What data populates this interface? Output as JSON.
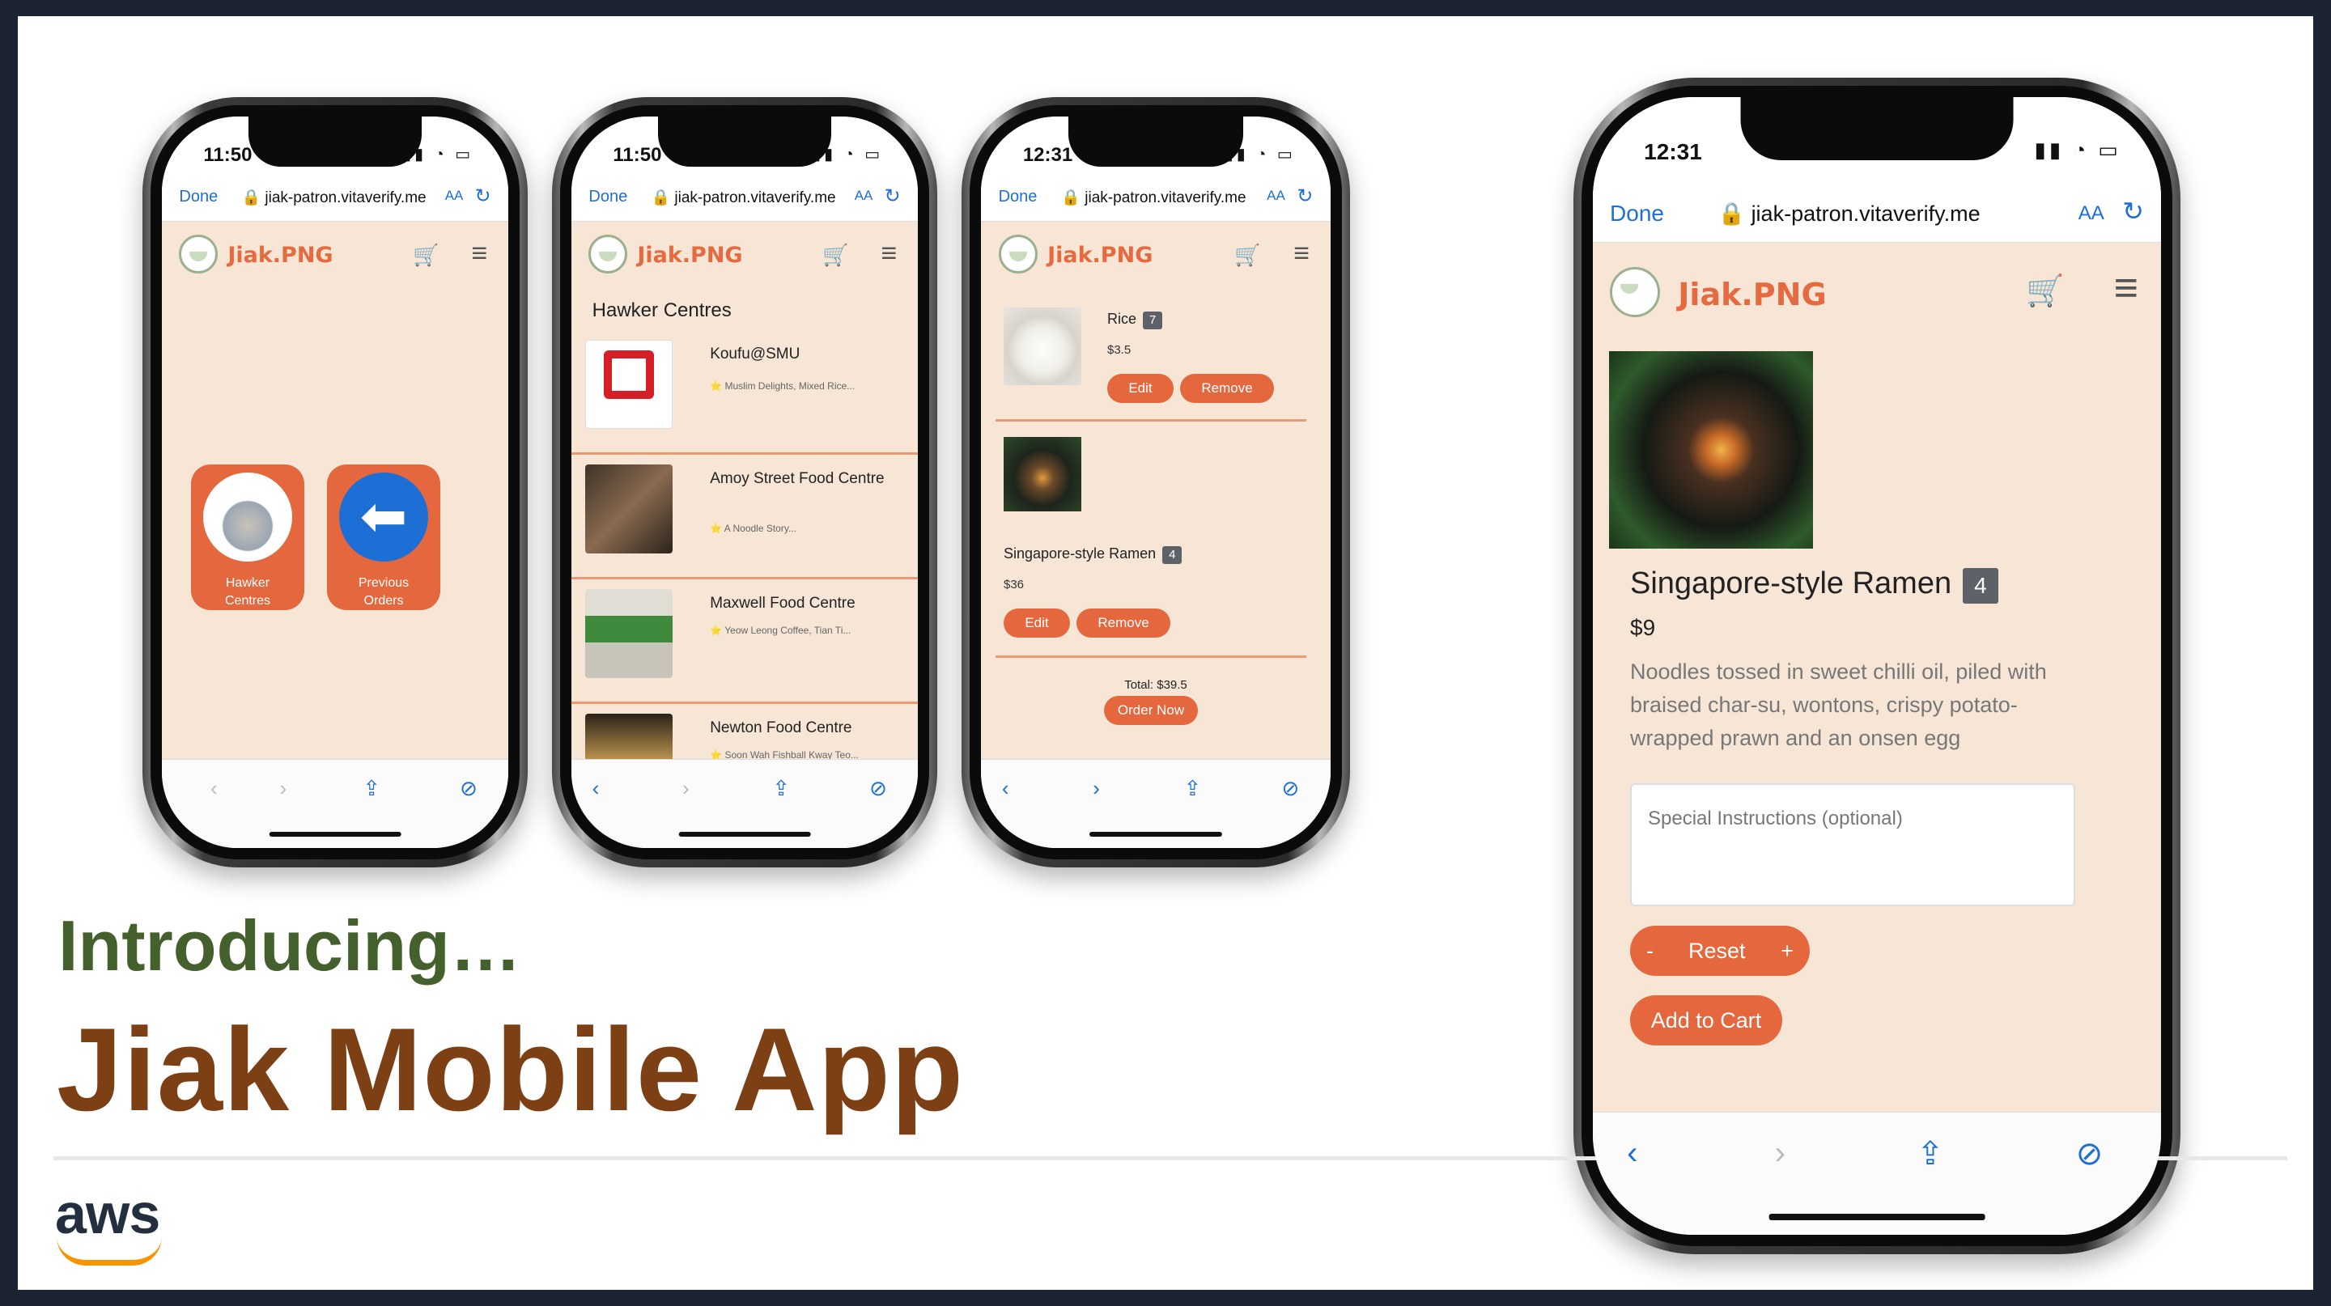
{
  "slide": {
    "intro": "Introducing…",
    "title": "Jiak Mobile App",
    "logo_text": "aws"
  },
  "browser": {
    "done": "Done",
    "url": "jiak-patron.vitaverify.me",
    "aa": "AA",
    "reload_icon": "reload-icon"
  },
  "app": {
    "brand": "Jiak.PNG",
    "cart_icon": "cart-icon",
    "menu_icon": "hamburger-icon"
  },
  "phone1": {
    "time": "11:50",
    "tiles": [
      {
        "label_line1": "Hawker",
        "label_line2": "Centres",
        "icon": "building-icon"
      },
      {
        "label_line1": "Previous",
        "label_line2": "Orders",
        "icon": "back-arrow-icon"
      }
    ]
  },
  "phone2": {
    "time": "11:50",
    "title": "Hawker Centres",
    "items": [
      {
        "name": "Koufu@SMU",
        "desc": "⭐ Muslim Delights, Mixed Rice..."
      },
      {
        "name": "Amoy Street Food Centre",
        "desc": "⭐ A Noodle Story..."
      },
      {
        "name": "Maxwell Food Centre",
        "desc": "⭐ Yeow Leong Coffee, Tian Ti..."
      },
      {
        "name": "Newton Food Centre",
        "desc": "⭐ Soon Wah Fishball Kway Teo..."
      }
    ]
  },
  "phone3": {
    "time": "12:31",
    "items": [
      {
        "name": "Rice",
        "qty": "7",
        "price": "$3.5"
      },
      {
        "name": "Singapore-style Ramen",
        "qty": "4",
        "price": "$36"
      }
    ],
    "edit": "Edit",
    "remove": "Remove",
    "total": "Total: $39.5",
    "order_now": "Order Now"
  },
  "phone4": {
    "time": "12:31",
    "dish": "Singapore-style Ramen",
    "qty": "4",
    "price": "$9",
    "description": "Noodles tossed in sweet chilli oil, piled with braised char-su, wontons, crispy potato-wrapped prawn and an onsen egg",
    "instructions_placeholder": "Special Instructions (optional)",
    "minus": "-",
    "reset": "Reset",
    "plus": "+",
    "add_to_cart": "Add to Cart"
  },
  "nav_icons": {
    "back": "‹",
    "forward": "›",
    "share": "⇪",
    "compass": "⊘"
  },
  "colors": {
    "brand_orange": "#e5673e",
    "screen_bg": "#f7e6d6",
    "intro_green": "#44602c",
    "title_brown": "#7d3f14",
    "aws_orange": "#f79400"
  }
}
